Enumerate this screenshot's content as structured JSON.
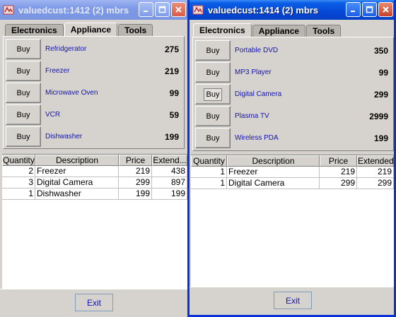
{
  "windows": [
    {
      "title": "valuedcust:1412 (2) mbrs",
      "active": false,
      "tabs": [
        "Electronics",
        "Appliance",
        "Tools"
      ],
      "selected_tab": "Appliance",
      "products": [
        {
          "buy_label": "Buy",
          "name": "Refridgerator",
          "price": "275"
        },
        {
          "buy_label": "Buy",
          "name": "Freezer",
          "price": "219"
        },
        {
          "buy_label": "Buy",
          "name": "Microwave Oven",
          "price": "99"
        },
        {
          "buy_label": "Buy",
          "name": "VCR",
          "price": "59"
        },
        {
          "buy_label": "Buy",
          "name": "Dishwasher",
          "price": "199"
        }
      ],
      "table": {
        "columns": [
          "Quantity",
          "Description",
          "Price",
          "Extend..."
        ],
        "rows": [
          [
            "2",
            "Freezer",
            "219",
            "438"
          ],
          [
            "3",
            "Digital Camera",
            "299",
            "897"
          ],
          [
            "1",
            "Dishwasher",
            "199",
            "199"
          ]
        ]
      },
      "exit_label": "Exit"
    },
    {
      "title": "valuedcust:1414 (2) mbrs",
      "active": true,
      "tabs": [
        "Electronics",
        "Appliance",
        "Tools"
      ],
      "selected_tab": "Electronics",
      "products": [
        {
          "buy_label": "Buy",
          "name": "Portable DVD",
          "price": "350"
        },
        {
          "buy_label": "Buy",
          "name": "MP3 Player",
          "price": "99"
        },
        {
          "buy_label": "Buy",
          "name": "Digital Camera",
          "price": "299",
          "focused": true
        },
        {
          "buy_label": "Buy",
          "name": "Plasma TV",
          "price": "2999"
        },
        {
          "buy_label": "Buy",
          "name": "Wireless PDA",
          "price": "199"
        }
      ],
      "table": {
        "columns": [
          "Quantity",
          "Description",
          "Price",
          "Extended"
        ],
        "rows": [
          [
            "1",
            "Freezer",
            "219",
            "219"
          ],
          [
            "1",
            "Digital Camera",
            "299",
            "299"
          ]
        ]
      },
      "exit_label": "Exit"
    }
  ],
  "colors": {
    "link_blue": "#1414b4",
    "active_border": "#0831d9",
    "panel_gray": "#d6d3ce"
  },
  "icons": [
    "app-icon",
    "minimize-icon",
    "maximize-icon",
    "close-icon"
  ]
}
